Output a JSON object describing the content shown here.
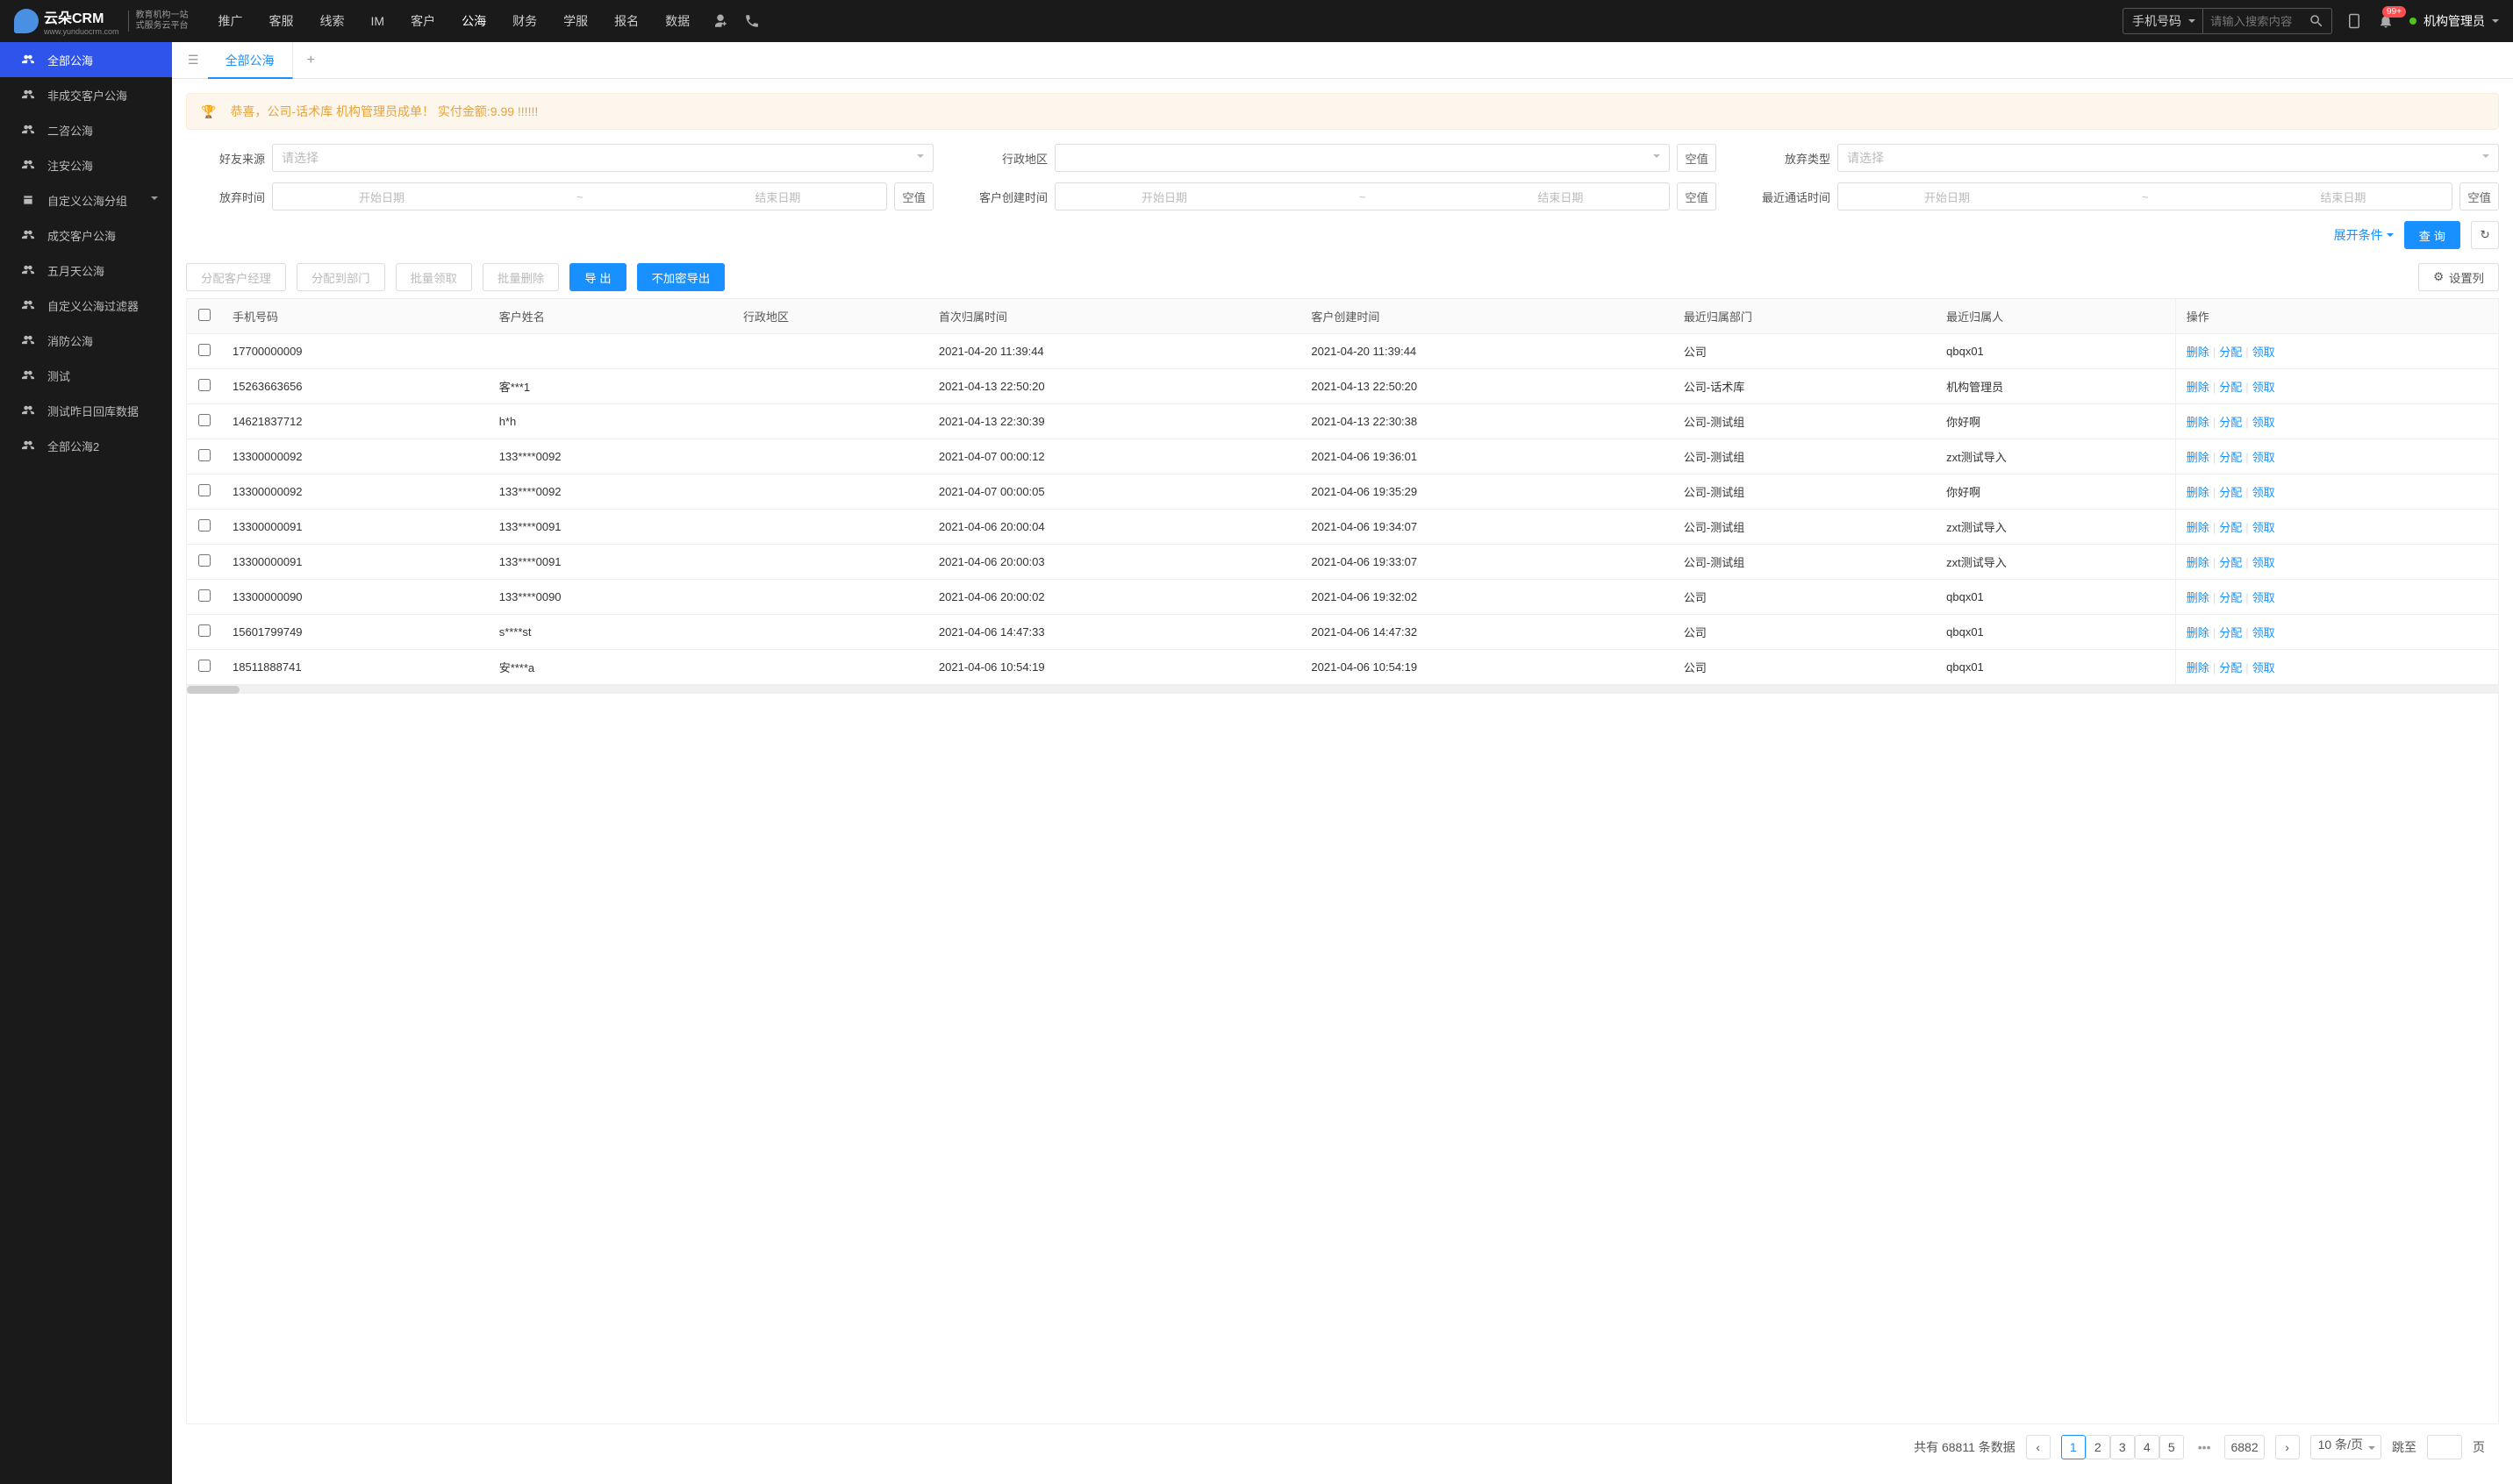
{
  "brand": {
    "name": "云朵CRM",
    "url": "www.yunduocrm.com",
    "sub1": "教育机构一站",
    "sub2": "式服务云平台"
  },
  "nav": {
    "items": [
      "推广",
      "客服",
      "线索",
      "IM",
      "客户",
      "公海",
      "财务",
      "学服",
      "报名",
      "数据"
    ],
    "active_index": 5
  },
  "topbar": {
    "search_type": "手机号码",
    "search_placeholder": "请输入搜索内容",
    "badge": "99+",
    "user_name": "机构管理员"
  },
  "tabs": {
    "active": "全部公海"
  },
  "sidebar": {
    "items": [
      {
        "label": "全部公海",
        "active": true,
        "has_chevron": false
      },
      {
        "label": "非成交客户公海",
        "active": false,
        "has_chevron": false
      },
      {
        "label": "二咨公海",
        "active": false,
        "has_chevron": false
      },
      {
        "label": "注安公海",
        "active": false,
        "has_chevron": false
      },
      {
        "label": "自定义公海分组",
        "active": false,
        "has_chevron": true
      },
      {
        "label": "成交客户公海",
        "active": false,
        "has_chevron": false
      },
      {
        "label": "五月天公海",
        "active": false,
        "has_chevron": false
      },
      {
        "label": "自定义公海过滤器",
        "active": false,
        "has_chevron": false
      },
      {
        "label": "消防公海",
        "active": false,
        "has_chevron": false
      },
      {
        "label": "测试",
        "active": false,
        "has_chevron": false
      },
      {
        "label": "测试昨日回库数据",
        "active": false,
        "has_chevron": false
      },
      {
        "label": "全部公海2",
        "active": false,
        "has_chevron": false
      }
    ]
  },
  "alert": {
    "text": "恭喜，公司-话术库  机构管理员成单！  实付金额:9.99 !!!!!!"
  },
  "filters": {
    "f1_label": "好友来源",
    "f1_placeholder": "请选择",
    "f2_label": "行政地区",
    "f2_null": "空值",
    "f3_label": "放弃类型",
    "f3_placeholder": "请选择",
    "f4_label": "放弃时间",
    "start": "开始日期",
    "end": "结束日期",
    "f4_null": "空值",
    "f5_label": "客户创建时间",
    "f5_null": "空值",
    "f6_label": "最近通话时间",
    "f6_null": "空值",
    "expand": "展开条件",
    "query": "查 询"
  },
  "actions": {
    "a1": "分配客户经理",
    "a2": "分配到部门",
    "a3": "批量领取",
    "a4": "批量删除",
    "a5": "导 出",
    "a6": "不加密导出",
    "a7": "设置列"
  },
  "table": {
    "headers": [
      "手机号码",
      "客户姓名",
      "行政地区",
      "首次归属时间",
      "客户创建时间",
      "最近归属部门",
      "最近归属人",
      "操作"
    ],
    "ops": {
      "del": "删除",
      "assign": "分配",
      "claim": "领取"
    },
    "rows": [
      {
        "phone": "17700000009",
        "name": "",
        "region": "",
        "first": "2021-04-20 11:39:44",
        "created": "2021-04-20 11:39:44",
        "dept": "公司",
        "owner": "qbqx01"
      },
      {
        "phone": "15263663656",
        "name": "客***1",
        "region": "",
        "first": "2021-04-13 22:50:20",
        "created": "2021-04-13 22:50:20",
        "dept": "公司-话术库",
        "owner": "机构管理员"
      },
      {
        "phone": "14621837712",
        "name": "h*h",
        "region": "",
        "first": "2021-04-13 22:30:39",
        "created": "2021-04-13 22:30:38",
        "dept": "公司-测试组",
        "owner": "你好啊"
      },
      {
        "phone": "13300000092",
        "name": "133****0092",
        "region": "",
        "first": "2021-04-07 00:00:12",
        "created": "2021-04-06 19:36:01",
        "dept": "公司-测试组",
        "owner": "zxt测试导入"
      },
      {
        "phone": "13300000092",
        "name": "133****0092",
        "region": "",
        "first": "2021-04-07 00:00:05",
        "created": "2021-04-06 19:35:29",
        "dept": "公司-测试组",
        "owner": "你好啊"
      },
      {
        "phone": "13300000091",
        "name": "133****0091",
        "region": "",
        "first": "2021-04-06 20:00:04",
        "created": "2021-04-06 19:34:07",
        "dept": "公司-测试组",
        "owner": "zxt测试导入"
      },
      {
        "phone": "13300000091",
        "name": "133****0091",
        "region": "",
        "first": "2021-04-06 20:00:03",
        "created": "2021-04-06 19:33:07",
        "dept": "公司-测试组",
        "owner": "zxt测试导入"
      },
      {
        "phone": "13300000090",
        "name": "133****0090",
        "region": "",
        "first": "2021-04-06 20:00:02",
        "created": "2021-04-06 19:32:02",
        "dept": "公司",
        "owner": "qbqx01"
      },
      {
        "phone": "15601799749",
        "name": "s****st",
        "region": "",
        "first": "2021-04-06 14:47:33",
        "created": "2021-04-06 14:47:32",
        "dept": "公司",
        "owner": "qbqx01"
      },
      {
        "phone": "18511888741",
        "name": "安****a",
        "region": "",
        "first": "2021-04-06 10:54:19",
        "created": "2021-04-06 10:54:19",
        "dept": "公司",
        "owner": "qbqx01"
      }
    ]
  },
  "pagination": {
    "total_prefix": "共有 ",
    "total": "68811",
    "total_suffix": " 条数据",
    "pages": [
      "1",
      "2",
      "3",
      "4",
      "5"
    ],
    "last_page": "6882",
    "page_size": "10 条/页",
    "jump_prefix": "跳至",
    "jump_suffix": "页"
  }
}
